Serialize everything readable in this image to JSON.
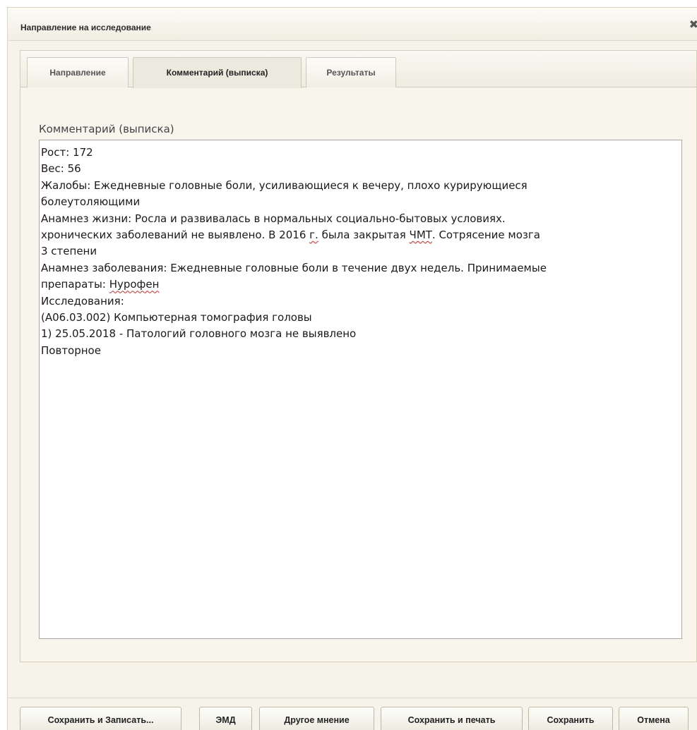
{
  "dialog": {
    "title": "Направление на исследование",
    "close_glyph": "✖"
  },
  "tabs": [
    {
      "label": "Направление",
      "active": false
    },
    {
      "label": "Комментарий (выписка)",
      "active": true
    },
    {
      "label": "Результаты",
      "active": false
    }
  ],
  "comment": {
    "label": "Комментарий (выписка)",
    "lines": [
      "Рост: 172",
      "Вес: 56",
      "Жалобы: Ежедневные головные боли, усиливающиеся к вечеру, плохо курирующиеся",
      "болеутоляющими",
      "Анамнез жизни: Росла и развивалась в нормальных социально-бытовых условиях.",
      "хронических заболеваний не выявлено. В 2016 г. была закрытая ЧМТ. Сотрясение мозга",
      "3 степени",
      "Анамнез заболевания: Ежедневные головные боли в течение двух недель. Принимаемые",
      "препараты: Нурофен",
      "Исследования:",
      "(А06.03.002) Компьютерная томография головы",
      "1) 25.05.2018 - Патологий головного мозга не выявлено",
      "Повторное"
    ],
    "line6_parts": [
      "хронических заболеваний не выявлено. В 2016 ",
      "г.",
      " была закрытая ",
      "ЧМТ",
      ". Сотрясение мозга"
    ],
    "line9_parts": [
      "препараты: ",
      "Нурофен"
    ]
  },
  "buttons": {
    "save_and_book": "Сохранить и Записать...",
    "emd": "ЭМД",
    "other_opinion": "Другое мнение",
    "save_and_print": "Сохранить и печать",
    "save": "Сохранить",
    "cancel": "Отмена"
  },
  "colors": {
    "panel_bg": "#f6f4ea",
    "spellcheck": "#dd2222"
  }
}
